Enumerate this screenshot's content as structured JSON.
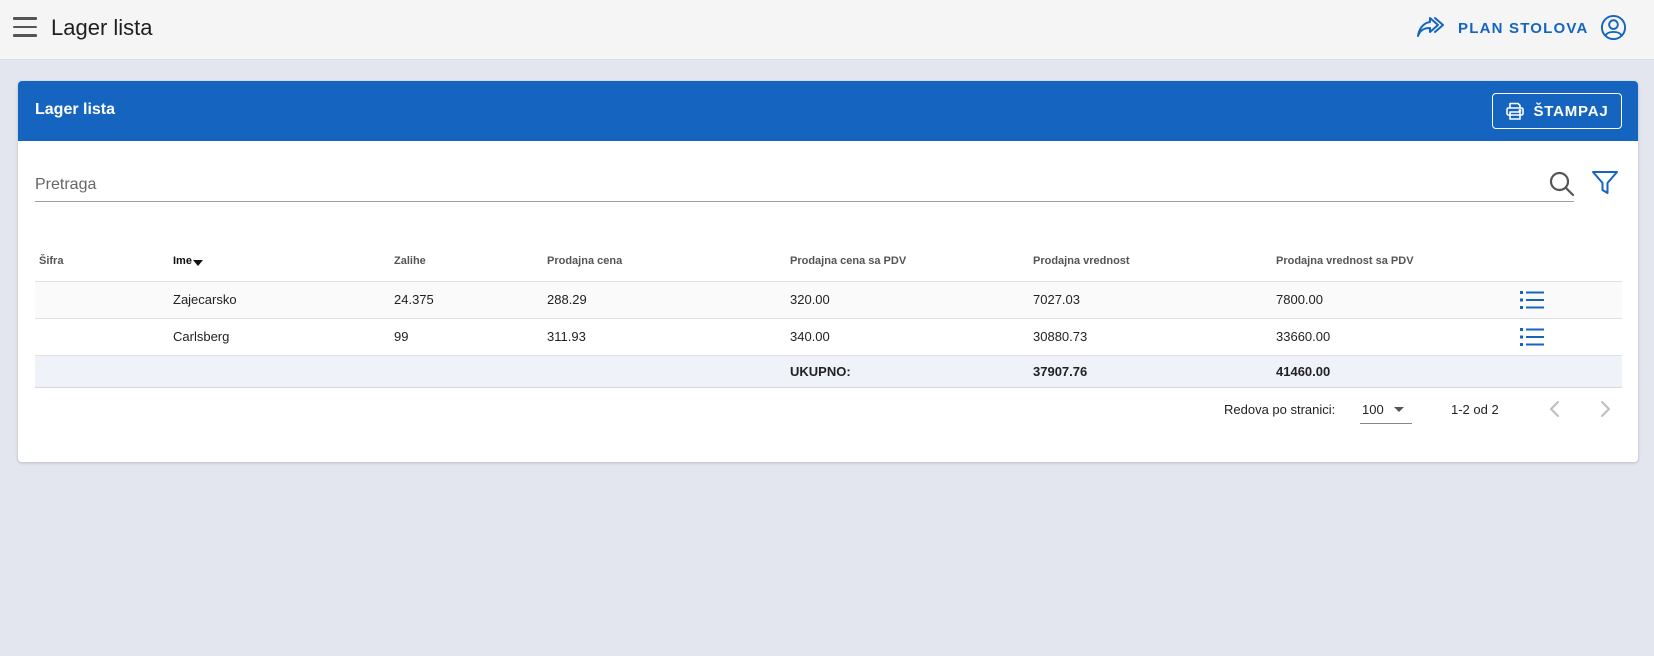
{
  "app": {
    "title": "Lager lista",
    "plan_label": "PLAN STOLOVA"
  },
  "card": {
    "title": "Lager lista",
    "print_label": "ŠTAMPAJ"
  },
  "search": {
    "placeholder": "Pretraga",
    "value": ""
  },
  "table": {
    "columns": [
      "Šifra",
      "Ime",
      "Zalihe",
      "Prodajna cena",
      "Prodajna cena sa PDV",
      "Prodajna vrednost",
      "Prodajna vrednost sa PDV"
    ],
    "rows": [
      {
        "sifra": "",
        "ime": "Zajecarsko",
        "zalihe": "24.375",
        "cena": "288.29",
        "cena_pdv": "320.00",
        "vrednost": "7027.03",
        "vrednost_pdv": "7800.00"
      },
      {
        "sifra": "",
        "ime": "Carlsberg",
        "zalihe": "99",
        "cena": "311.93",
        "cena_pdv": "340.00",
        "vrednost": "30880.73",
        "vrednost_pdv": "33660.00"
      }
    ],
    "total": {
      "label": "UKUPNO:",
      "vrednost": "37907.76",
      "vrednost_pdv": "41460.00"
    }
  },
  "pagination": {
    "rows_label": "Redova po stranici:",
    "rows_per_page": "100",
    "range": "1-2 od 2"
  },
  "colors": {
    "primary": "#1565c0",
    "background": "#e3e6ee",
    "topbar": "#f5f5f5"
  }
}
